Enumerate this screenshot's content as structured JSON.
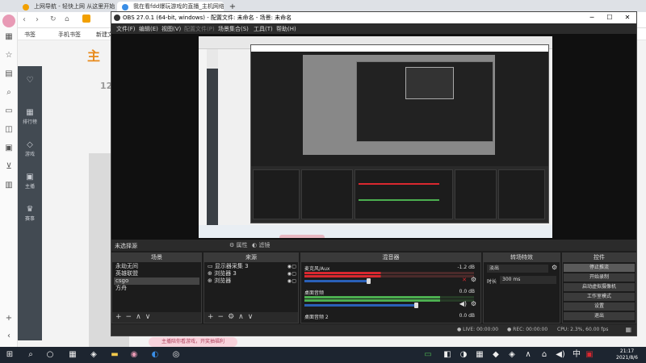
{
  "browser": {
    "tabs": [
      {
        "label": "上网导航 - 轻快上网 从这里开始"
      },
      {
        "label": "我在看fdd爆玩游戏的直播_主机网络游戏"
      }
    ],
    "new_tab": "+",
    "bookmarks": [
      "书签",
      "手机书签",
      "新建文件夹"
    ],
    "site_logo_text": "主",
    "left_text_1": "12",
    "gamebar_items": [
      {
        "label": "",
        "glyph": "♡"
      },
      {
        "label": "排行榜",
        "glyph": "▦"
      },
      {
        "label": "游戏",
        "glyph": "◇"
      },
      {
        "label": "主播",
        "glyph": "▣"
      },
      {
        "label": "热门",
        "glyph": "✦"
      },
      {
        "label": "",
        "glyph": "✦"
      },
      {
        "label": "赛事",
        "glyph": "♛"
      }
    ]
  },
  "obs": {
    "title": "OBS 27.0.1 (64-bit, windows) - 配置文件: 未命名 - 场景: 未命名",
    "menu": [
      "文件(F)",
      "编辑(E)",
      "视图(V)",
      "配置文件(P)",
      "场景集合(S)",
      "工具(T)",
      "帮助(H)"
    ],
    "scene_strip": {
      "left": "未选择源",
      "properties": "属性",
      "filters": "滤镜"
    },
    "scenes": {
      "title": "场景",
      "items": [
        "永劫无间",
        "英雄联盟",
        "csgo",
        "方舟"
      ]
    },
    "sources": {
      "title": "来源",
      "items": [
        "显示器采集 3",
        "浏览器 3",
        "浏览器"
      ]
    },
    "mixer": {
      "title": "混音器",
      "channels": [
        {
          "name": "麦克风/Aux",
          "db": "-1.2 dB",
          "level": 0.45
        },
        {
          "name": "桌面音频",
          "db": "0.0 dB",
          "level": 0.8
        },
        {
          "name": "桌面音频 2",
          "db": "0.0 dB",
          "level": 0.0
        }
      ]
    },
    "transitions": {
      "title": "转场特效",
      "type": "淡出",
      "duration_label": "时长",
      "duration": "300 ms"
    },
    "controls": {
      "title": "控件",
      "buttons": [
        "停止推流",
        "开始录制",
        "启动虚拟摄像机",
        "工作室模式",
        "设置",
        "退出"
      ]
    },
    "status": {
      "live": "LIVE: 00:00:00",
      "rec": "REC: 00:00:00",
      "cpu": "CPU: 2.3%, 60.00 fps"
    }
  },
  "notification": "主播陪你看游戏，开奖抽福利",
  "taskbar": {
    "time": "21:17",
    "date": "2021/8/6"
  },
  "colors": {
    "obs_bg": "#1e1e1e",
    "accent_blue": "#2a60b8",
    "meter_green": "#4caf50",
    "meter_red": "#d9282f"
  }
}
